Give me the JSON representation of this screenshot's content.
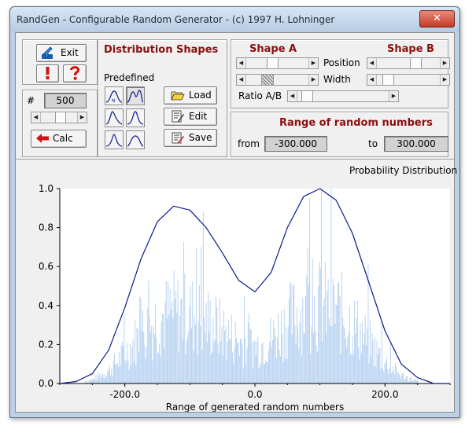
{
  "window": {
    "title": "RandGen - Configurable Random Generator - (c) 1997 H. Lohninger",
    "close_glyph": "✕"
  },
  "controls": {
    "exit_label": "Exit",
    "count_prefix": "#",
    "count_value": "500",
    "calc_label": "Calc"
  },
  "distribution": {
    "header": "Distribution Shapes",
    "predefined_label": "Predefined",
    "load_label": "Load",
    "edit_label": "Edit",
    "save_label": "Save"
  },
  "shapes": {
    "shape_a_label": "Shape A",
    "shape_b_label": "Shape B",
    "position_label": "Position",
    "width_label": "Width",
    "ratio_label": "Ratio A/B"
  },
  "range": {
    "header": "Range of random numbers",
    "from_label": "from",
    "from_value": "-300.000",
    "to_label": "to",
    "to_value": "300.000"
  },
  "chart_data": {
    "type": "line",
    "title": "Probability Distribution",
    "xlabel": "Range of generated random numbers",
    "ylabel": "",
    "xlim": [
      -300,
      300
    ],
    "ylim": [
      0,
      1.0
    ],
    "x_ticks": [
      "-200.0",
      "0.0",
      "200.0"
    ],
    "y_ticks": [
      "0.0",
      "0.2",
      "0.4",
      "0.6",
      "0.8",
      "1.0"
    ],
    "series": [
      {
        "x": [
          -300,
          -275,
          -250,
          -225,
          -200,
          -175,
          -150,
          -125,
          -100,
          -75,
          -50,
          -25,
          0,
          25,
          50,
          75,
          100,
          125,
          150,
          175,
          200,
          225,
          250,
          275,
          300
        ],
        "values": [
          0.0,
          0.01,
          0.05,
          0.17,
          0.39,
          0.64,
          0.83,
          0.91,
          0.89,
          0.8,
          0.67,
          0.53,
          0.47,
          0.57,
          0.8,
          0.96,
          1.0,
          0.94,
          0.77,
          0.52,
          0.27,
          0.1,
          0.03,
          0.0,
          0.0
        ]
      }
    ],
    "histogram_color": "#b8d3f2",
    "line_color": "#0a1a8a"
  }
}
